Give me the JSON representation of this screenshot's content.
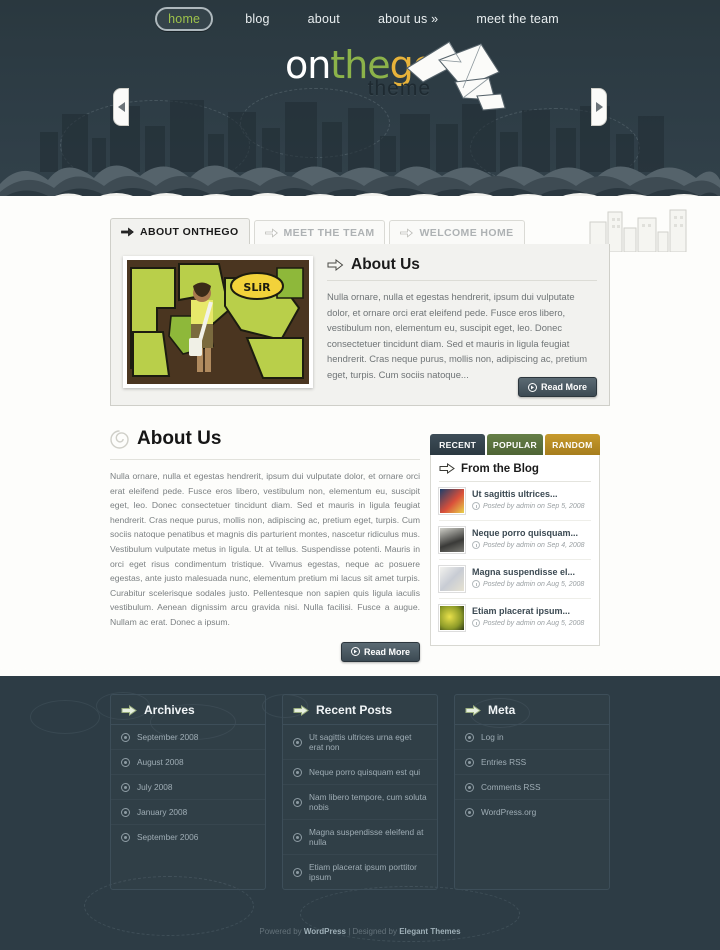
{
  "nav": {
    "items": [
      {
        "label": "home",
        "active": true
      },
      {
        "label": "blog",
        "active": false
      },
      {
        "label": "about",
        "active": false
      },
      {
        "label": "about us »",
        "active": false
      },
      {
        "label": "meet the team",
        "active": false
      }
    ]
  },
  "logo": {
    "part1": "on",
    "part2": "the",
    "part3": "go",
    "subtitle": "theme",
    "color1": "#ffffff",
    "color2": "#8cb34a",
    "color3": "#e8b33a"
  },
  "feature": {
    "tabs": [
      {
        "label": "ABOUT ONTHEGO",
        "active": true
      },
      {
        "label": "MEET THE TEAM",
        "active": false
      },
      {
        "label": "WELCOME HOME",
        "active": false
      }
    ],
    "heading": "About Us",
    "body": "Nulla ornare, nulla et egestas hendrerit, ipsum dui vulputate dolor, et ornare orci erat eleifend pede. Fusce eros libero, vestibulum non, elementum eu, suscipit eget, leo. Donec consectetuer tincidunt diam. Sed et mauris in ligula feugiat hendrerit. Cras neque purus, mollis non, adipiscing ac, pretium eget, turpis. Cum sociis natoque...",
    "read_more": "Read More"
  },
  "article": {
    "heading": "About Us",
    "paragraph1": "Nulla ornare, nulla et egestas hendrerit, ipsum dui vulputate dolor, et ornare orci erat eleifend pede. Fusce eros libero, vestibulum non, elementum eu, suscipit eget, leo. Donec consectetuer tincidunt diam. Sed et mauris in ligula feugiat hendrerit. Cras neque purus, mollis non, adipiscing ac, pretium eget, turpis. Cum sociis natoque penatibus et magnis dis parturient montes, nascetur ridiculus mus. Vestibulum vulputate metus in ligula. Ut at tellus. Suspendisse potenti. Mauris in orci eget risus condimentum tristique. Vivamus egestas, neque ac posuere egestas, ante justo malesuada nunc, elementum pretium mi lacus sit amet turpis. Curabitur scelerisque sodales justo. Pellentesque non sapien quis ligula iaculis vestibulum. Aenean dignissim arcu gravida nisi. Nulla facilisi. Fusce a augue. Nullam ac erat. Donec a ipsum.",
    "read_more": "Read More"
  },
  "sidebar": {
    "tabs": [
      {
        "label": "RECENT",
        "color": "#2b3941",
        "active": true
      },
      {
        "label": "POPULAR",
        "color": "#4e6435",
        "active": false
      },
      {
        "label": "RANDOM",
        "color": "#a67d1d",
        "active": false
      }
    ],
    "widget_title": "From the Blog",
    "posts": [
      {
        "title": "Ut sagittis ultrices...",
        "meta": "Posted by admin on Sep 5, 2008",
        "thumb": "#d94f3a"
      },
      {
        "title": "Neque porro quisquam...",
        "meta": "Posted by admin on Sep 4, 2008",
        "thumb": "#6a6a6a"
      },
      {
        "title": "Magna suspendisse el...",
        "meta": "Posted by admin on Aug 5, 2008",
        "thumb": "#e8e8e0"
      },
      {
        "title": "Etiam placerat ipsum...",
        "meta": "Posted by admin on Aug 5, 2008",
        "thumb": "#7c8c2a"
      }
    ]
  },
  "footer": {
    "widgets": [
      {
        "title": "Archives",
        "items": [
          "September 2008",
          "August 2008",
          "July 2008",
          "January 2008",
          "September 2006"
        ]
      },
      {
        "title": "Recent Posts",
        "items": [
          "Ut sagittis ultrices urna eget erat non",
          "Neque porro quisquam est qui",
          "Nam libero tempore, cum soluta nobis",
          "Magna suspendisse eleifend at nulla",
          "Etiam placerat ipsum porttitor ipsum"
        ]
      },
      {
        "title": "Meta",
        "items": [
          "Log in",
          "Entries RSS",
          "Comments RSS",
          "WordPress.org"
        ]
      }
    ],
    "credit_prefix": "Powered by ",
    "credit_wp": "WordPress",
    "credit_mid": " | Designed by ",
    "credit_et": "Elegant Themes"
  },
  "theme": {
    "bg_dark": "#2d3c45",
    "paper": "#fdfdfb",
    "accent_green": "#8cb34a",
    "accent_gold": "#e8b33a"
  }
}
